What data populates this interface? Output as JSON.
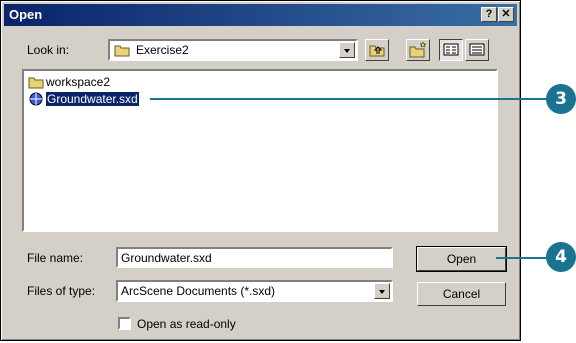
{
  "window": {
    "title": "Open",
    "help_label": "?",
    "close_label": "✕"
  },
  "look_in": {
    "label": "Look in:",
    "value": "Exercise2"
  },
  "files": [
    {
      "name": "workspace2",
      "icon": "folder-icon"
    },
    {
      "name": "Groundwater.sxd",
      "icon": "scene-document-icon",
      "selected": true
    }
  ],
  "file_name": {
    "label": "File name:",
    "value": "Groundwater.sxd"
  },
  "file_type": {
    "label": "Files of type:",
    "value": "ArcScene Documents (*.sxd)"
  },
  "buttons": {
    "open": "Open",
    "cancel": "Cancel"
  },
  "readonly": {
    "label": "Open as read-only",
    "checked": false
  },
  "callouts": {
    "a": "3",
    "b": "4"
  },
  "colors": {
    "title_bar": "#0a246a",
    "selection": "#0a246a",
    "callout": "#1a7391"
  }
}
